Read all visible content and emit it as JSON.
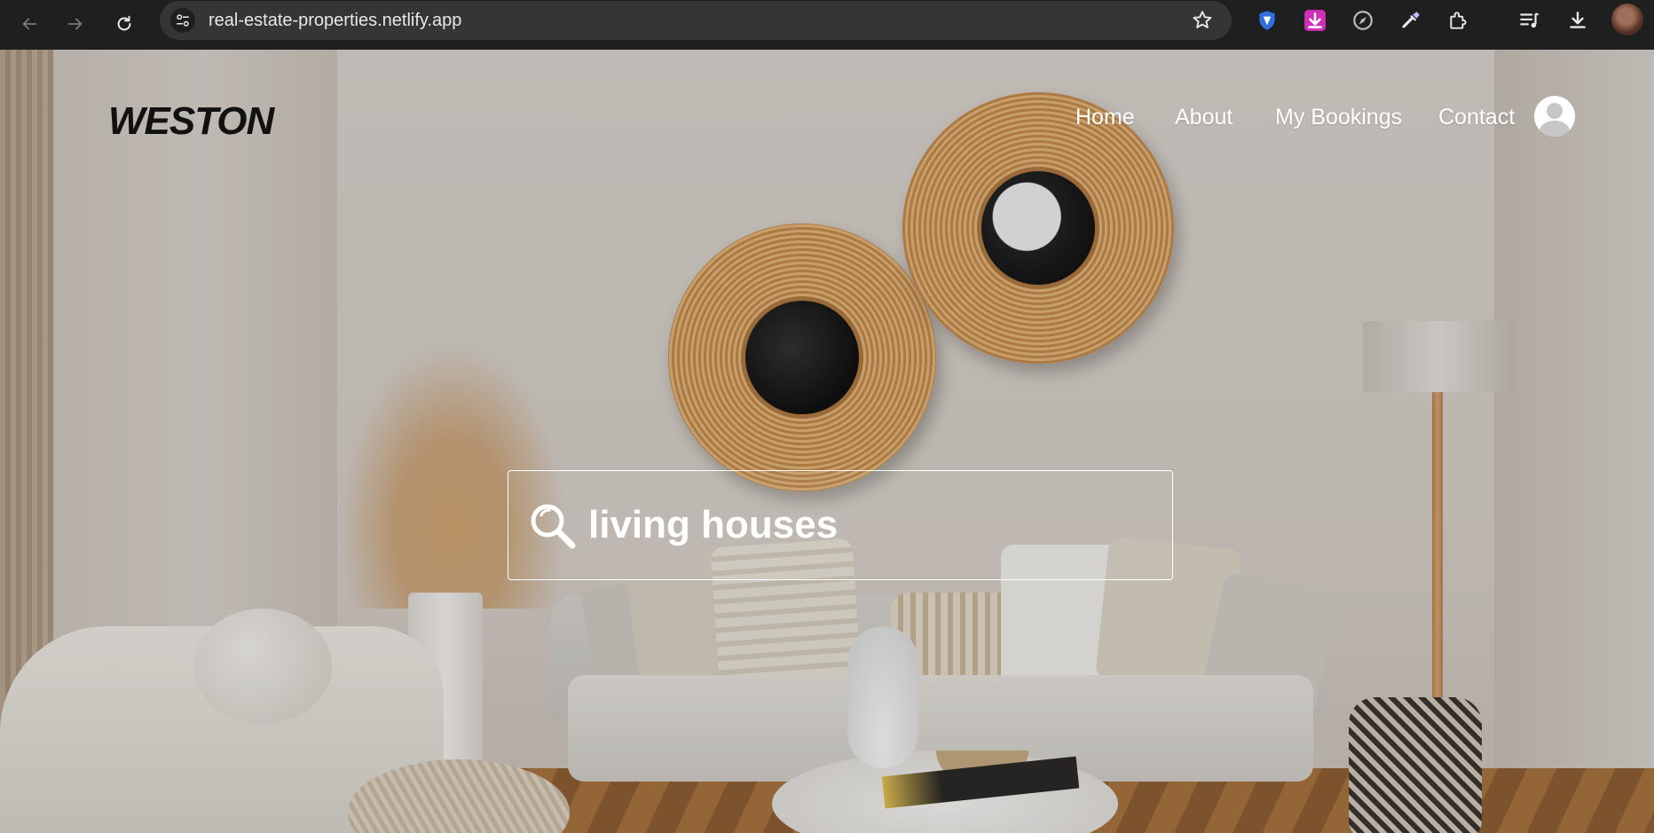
{
  "browser": {
    "url": "real-estate-properties.netlify.app",
    "icons": [
      "back-arrow-icon",
      "forward-arrow-icon",
      "reload-icon",
      "site-settings-icon",
      "bookmark-star-icon",
      "shield-extension-icon",
      "download-extension-icon",
      "compass-extension-icon",
      "eyedropper-extension-icon",
      "puzzle-extensions-icon",
      "media-queue-icon",
      "downloads-icon",
      "profile-avatar-icon"
    ]
  },
  "site": {
    "logo": "WESTON",
    "nav": {
      "home": "Home",
      "about": "About",
      "bookings": "My Bookings",
      "contact": "Contact"
    },
    "search": {
      "value": "living houses"
    }
  },
  "colors": {
    "chrome_bg": "#1f1f1f",
    "omnibox_bg": "#353535",
    "logo": "#111111",
    "nav_text": "#ffffff",
    "shield_ext": "#2f6fe0",
    "download_ext": "#d02fb8"
  }
}
